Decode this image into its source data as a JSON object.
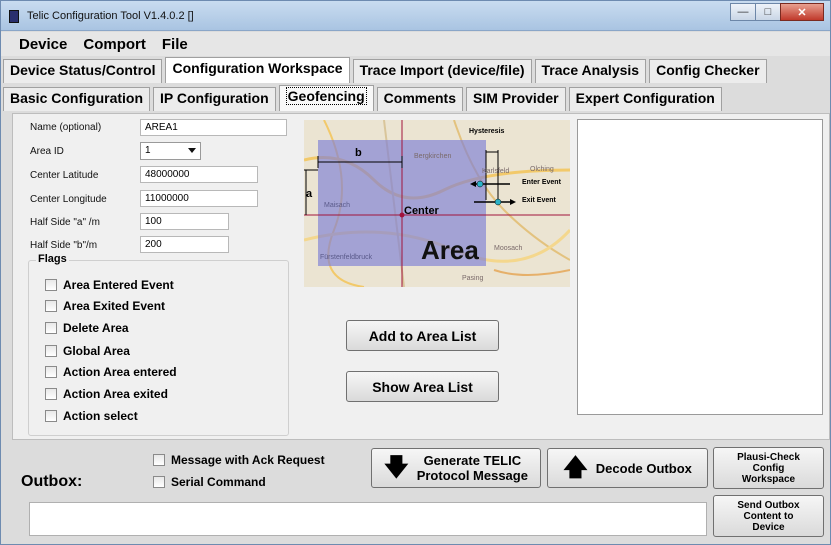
{
  "window": {
    "title": "Telic Configuration Tool V1.4.0.2 []"
  },
  "menu": [
    "Device",
    "Comport",
    "File"
  ],
  "main_tabs": [
    "Device Status/Control",
    "Configuration Workspace",
    "Trace Import (device/file)",
    "Trace Analysis",
    "Config Checker"
  ],
  "sub_tabs": [
    "Basic Configuration",
    "IP Configuration",
    "Geofencing",
    "Comments",
    "SIM Provider",
    "Expert Configuration"
  ],
  "form": {
    "name_label": "Name (optional)",
    "name_value": "AREA1",
    "area_id_label": "Area ID",
    "area_id_value": "1",
    "lat_label": "Center Latitude",
    "lat_value": "48000000",
    "lon_label": "Center Longitude",
    "lon_value": "11000000",
    "half_a_label": "Half Side \"a\" /m",
    "half_a_value": "100",
    "half_b_label": "Half Side \"b\"/m",
    "half_b_value": "200"
  },
  "flags": {
    "legend": "Flags",
    "items": [
      "Area Entered Event",
      "Area Exited Event",
      "Delete Area",
      "Global Area",
      "Action Area entered",
      "Action Area exited",
      "Action select"
    ]
  },
  "map": {
    "hysteresis": "Hysteresis",
    "b_label": "b",
    "a_label": "a",
    "center": "Center",
    "area": "Area",
    "enter_event": "Enter Event",
    "exit_event": "Exit Event",
    "places": [
      "Bergkirchen",
      "Maisach",
      "Fürstenfeldbruck",
      "Moosach",
      "Pasing",
      "Karlsfeld",
      "Olching"
    ]
  },
  "buttons": {
    "add_to_list": "Add to Area List",
    "show_list": "Show Area List",
    "generate_line1": "Generate TELIC",
    "generate_line2": "Protocol Message",
    "decode_outbox": "Decode Outbox",
    "plausi_line1": "Plausi-Check",
    "plausi_line2": "Config",
    "plausi_line3": "Workspace",
    "send_line1": "Send Outbox",
    "send_line2": "Content to",
    "send_line3": "Device"
  },
  "outbox": {
    "label": "Outbox:",
    "ack_request": "Message with Ack Request",
    "serial_command": "Serial Command"
  }
}
